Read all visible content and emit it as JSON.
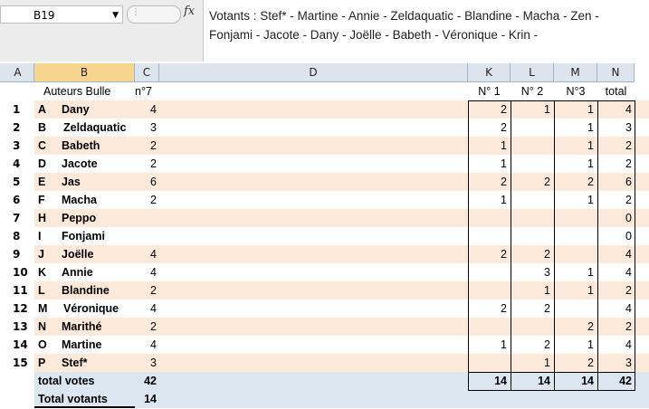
{
  "formula_bar": {
    "cell_ref": "B19",
    "dropdown_glyph": "▼",
    "fx_label": "fx",
    "formula_text": "Votants : Stef* - Martine - Annie - Zeldaquatic - Blandine - Macha - Zen - Fonjami - Jacote - Dany - Joëlle - Babeth - Véronique - Krin -"
  },
  "columns": [
    "A",
    "B",
    "C",
    "D",
    "K",
    "L",
    "M",
    "N"
  ],
  "header_row": {
    "b": "Auteurs      Bulle",
    "c": "n°7",
    "k": "N° 1",
    "l": "N° 2",
    "m": "N°3",
    "n": "total"
  },
  "rows": [
    {
      "num": "1",
      "letter": "A",
      "name": "Dany",
      "c": "4",
      "k": "2",
      "l": "1",
      "m": "1",
      "n": "4"
    },
    {
      "num": "2",
      "letter": "B",
      "name": "Zeldaquatic",
      "c": "3",
      "k": "2",
      "l": "",
      "m": "1",
      "n": "3"
    },
    {
      "num": "3",
      "letter": "C",
      "name": "Babeth",
      "c": "2",
      "k": "1",
      "l": "",
      "m": "1",
      "n": "2"
    },
    {
      "num": "4",
      "letter": "D",
      "name": "Jacote",
      "c": "2",
      "k": "1",
      "l": "",
      "m": "1",
      "n": "2"
    },
    {
      "num": "5",
      "letter": "E",
      "name": "Jas",
      "c": "6",
      "k": "2",
      "l": "2",
      "m": "2",
      "n": "6"
    },
    {
      "num": "6",
      "letter": "F",
      "name": "Macha",
      "c": "2",
      "k": "1",
      "l": "",
      "m": "1",
      "n": "2"
    },
    {
      "num": "7",
      "letter": "H",
      "name": "Peppo",
      "c": "",
      "k": "",
      "l": "",
      "m": "",
      "n": "0"
    },
    {
      "num": "8",
      "letter": "I",
      "name": "Fonjami",
      "c": "",
      "k": "",
      "l": "",
      "m": "",
      "n": "0"
    },
    {
      "num": "9",
      "letter": "J",
      "name": "Joëlle",
      "c": "4",
      "k": "2",
      "l": "2",
      "m": "",
      "n": "4"
    },
    {
      "num": "10",
      "letter": "K",
      "name": "Annie",
      "c": "4",
      "k": "",
      "l": "3",
      "m": "1",
      "n": "4"
    },
    {
      "num": "11",
      "letter": "L",
      "name": "Blandine",
      "c": "2",
      "k": "",
      "l": "1",
      "m": "1",
      "n": "2"
    },
    {
      "num": "12",
      "letter": "M",
      "name": "Véronique",
      "c": "4",
      "k": "2",
      "l": "2",
      "m": "",
      "n": "4"
    },
    {
      "num": "13",
      "letter": "N",
      "name": "Marithé",
      "c": "2",
      "k": "",
      "l": "",
      "m": "2",
      "n": "2"
    },
    {
      "num": "14",
      "letter": "O",
      "name": "Martine",
      "c": "4",
      "k": "1",
      "l": "2",
      "m": "1",
      "n": "4"
    },
    {
      "num": "15",
      "letter": "P",
      "name": "Stef*",
      "c": "3",
      "k": "",
      "l": "1",
      "m": "2",
      "n": "3"
    }
  ],
  "total_row": {
    "label": "total votes",
    "c": "42",
    "k": "14",
    "l": "14",
    "m": "14",
    "n": "42"
  },
  "votants_row": {
    "label": "Total votants",
    "c": "14"
  },
  "colors": {
    "shade": "#fde9d9",
    "total": "#dce6f1",
    "header": "#dde4ee",
    "selected_header": "#f7d58f"
  }
}
